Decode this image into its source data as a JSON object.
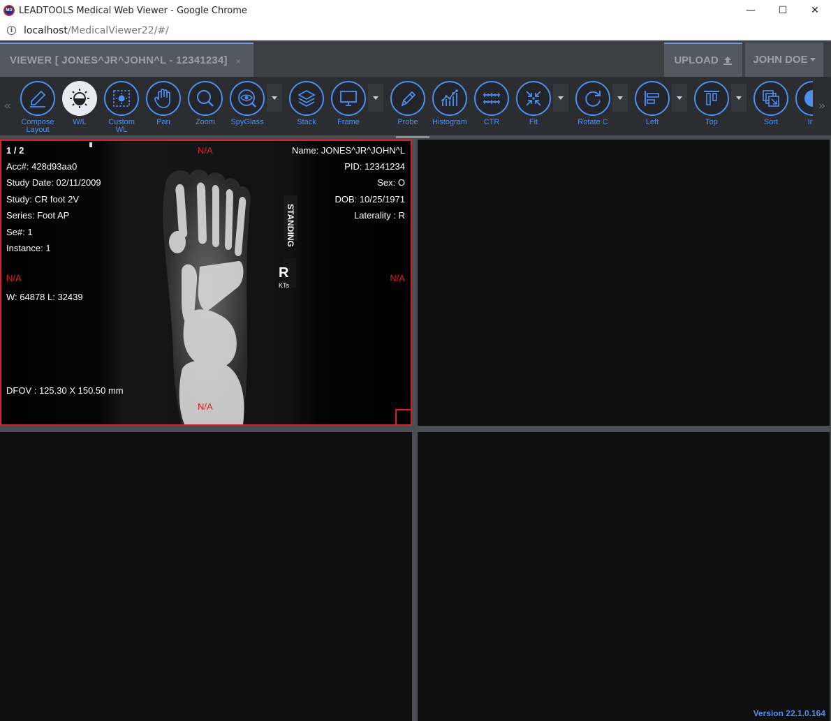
{
  "window": {
    "title": "LEADTOOLS Medical Web Viewer - Google Chrome",
    "minimize": "—",
    "maximize": "☐",
    "close": "✕"
  },
  "address": {
    "host": "localhost",
    "path": "/MedicalViewer22/#/"
  },
  "header": {
    "viewer_tab": "VIEWER [ JONES^JR^JOHN^L - 12341234]",
    "tab_close": "×",
    "upload": "UPLOAD",
    "user": "JOHN DOE"
  },
  "toolbar": {
    "nav_left": "«",
    "nav_right": "»",
    "tools": [
      {
        "label": "Compose Layout",
        "icon": "compose-layout-icon"
      },
      {
        "label": "W/L",
        "icon": "window-level-icon",
        "active": true
      },
      {
        "label": "Custom WL",
        "icon": "custom-wl-icon"
      },
      {
        "label": "Pan",
        "icon": "pan-hand-icon"
      },
      {
        "label": "Zoom",
        "icon": "zoom-magnifier-icon"
      },
      {
        "label": "SpyGlass",
        "icon": "spyglass-eye-icon"
      },
      {
        "label": "Stack",
        "icon": "stack-layers-icon"
      },
      {
        "label": "Frame",
        "icon": "frame-monitor-icon"
      },
      {
        "label": "Probe",
        "icon": "probe-pen-icon"
      },
      {
        "label": "Histogram",
        "icon": "histogram-icon"
      },
      {
        "label": "CTR",
        "icon": "ctr-ruler-icon"
      },
      {
        "label": "Fit",
        "icon": "fit-arrows-icon"
      },
      {
        "label": "Rotate C",
        "icon": "rotate-clockwise-icon"
      },
      {
        "label": "Left",
        "icon": "align-left-icon"
      },
      {
        "label": "Top",
        "icon": "align-top-icon"
      },
      {
        "label": "Sort",
        "icon": "sort-icon"
      },
      {
        "label": "Inv",
        "icon": "invert-icon"
      }
    ]
  },
  "viewport1": {
    "frame": "1 / 2",
    "top_center": "N/A",
    "acc": "Acc#: 428d93aa0",
    "study_date": "Study Date: 02/11/2009",
    "study": "Study: CR foot 2V",
    "series": "Series: Foot AP",
    "se_num": "Se#: 1",
    "instance": "Instance: 1",
    "left_center": "N/A",
    "wl": "W: 64878 L: 32439",
    "dfov": "DFOV : 125.30 X 150.50 mm",
    "bottom_center": "N/A",
    "name": "Name: JONES^JR^JOHN^L",
    "pid": "PID: 12341234",
    "sex": "Sex: O",
    "dob": "DOB: 10/25/1971",
    "laterality": "Laterality : R",
    "right_center": "N/A",
    "marker_standing": "STANDING",
    "marker_r": "R",
    "marker_initials": "KTs"
  },
  "footer": {
    "version": "Version 22.1.0.164"
  },
  "colors": {
    "accent": "#4f8ff0",
    "active_border": "#e02020",
    "toolbar_bg": "#2b2d31"
  }
}
